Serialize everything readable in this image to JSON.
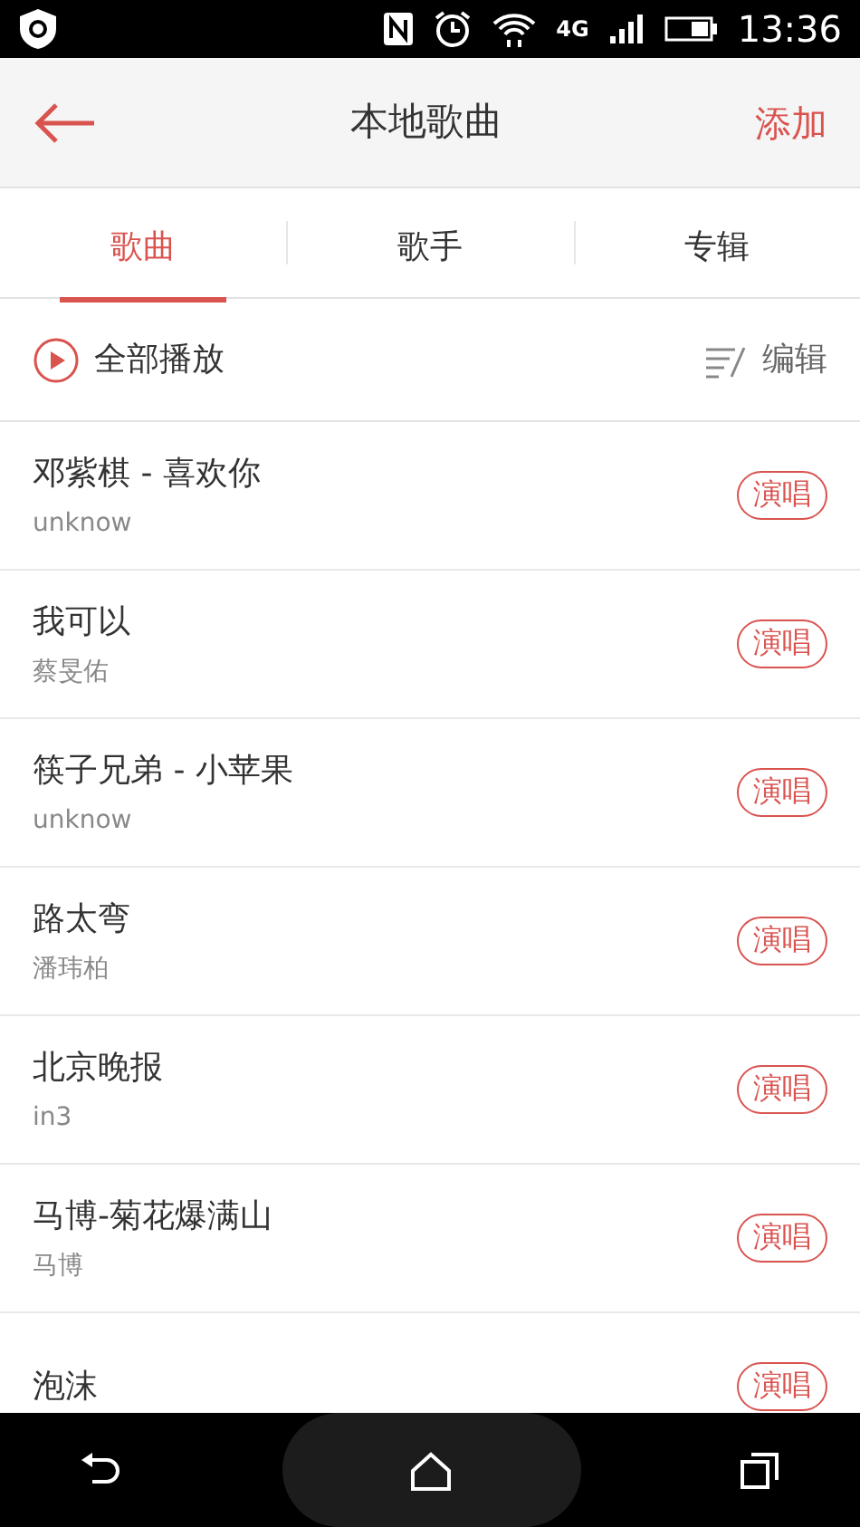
{
  "status_bar": {
    "network": "4G",
    "time": "13:36"
  },
  "header": {
    "title": "本地歌曲",
    "action": "添加"
  },
  "tabs": [
    {
      "label": "歌曲",
      "selected": true
    },
    {
      "label": "歌手",
      "selected": false
    },
    {
      "label": "专辑",
      "selected": false
    }
  ],
  "toolbar": {
    "play_all": "全部播放",
    "edit": "编辑"
  },
  "songs": [
    {
      "title": "邓紫棋 - 喜欢你",
      "artist": "unknow",
      "button": "演唱"
    },
    {
      "title": "我可以",
      "artist": "蔡旻佑",
      "button": "演唱"
    },
    {
      "title": "筷子兄弟 - 小苹果",
      "artist": "unknow",
      "button": "演唱"
    },
    {
      "title": "路太弯",
      "artist": "潘玮柏",
      "button": "演唱"
    },
    {
      "title": "北京晚报",
      "artist": "in3",
      "button": "演唱"
    },
    {
      "title": "马博-菊花爆满山",
      "artist": "马博",
      "button": "演唱"
    },
    {
      "title": "泡沫",
      "button": "演唱"
    }
  ]
}
